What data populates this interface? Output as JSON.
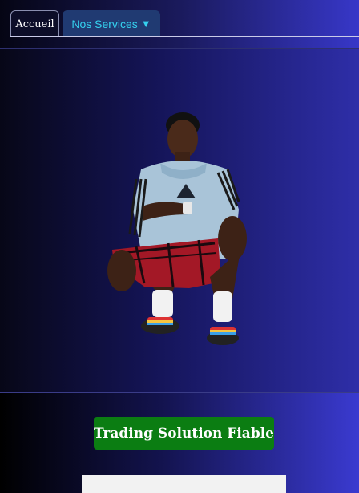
{
  "nav": {
    "tabs": [
      {
        "label": "Accueil"
      },
      {
        "label": "Nos Services",
        "caret": "▼"
      }
    ]
  },
  "hero": {
    "image": "person-crouching-photo"
  },
  "cta": {
    "label": "Trading Solution Fiable"
  },
  "colors": {
    "cta_bg": "#0b7d12",
    "services_tab_text": "#35d0ee",
    "services_tab_bg": "#203a72"
  }
}
